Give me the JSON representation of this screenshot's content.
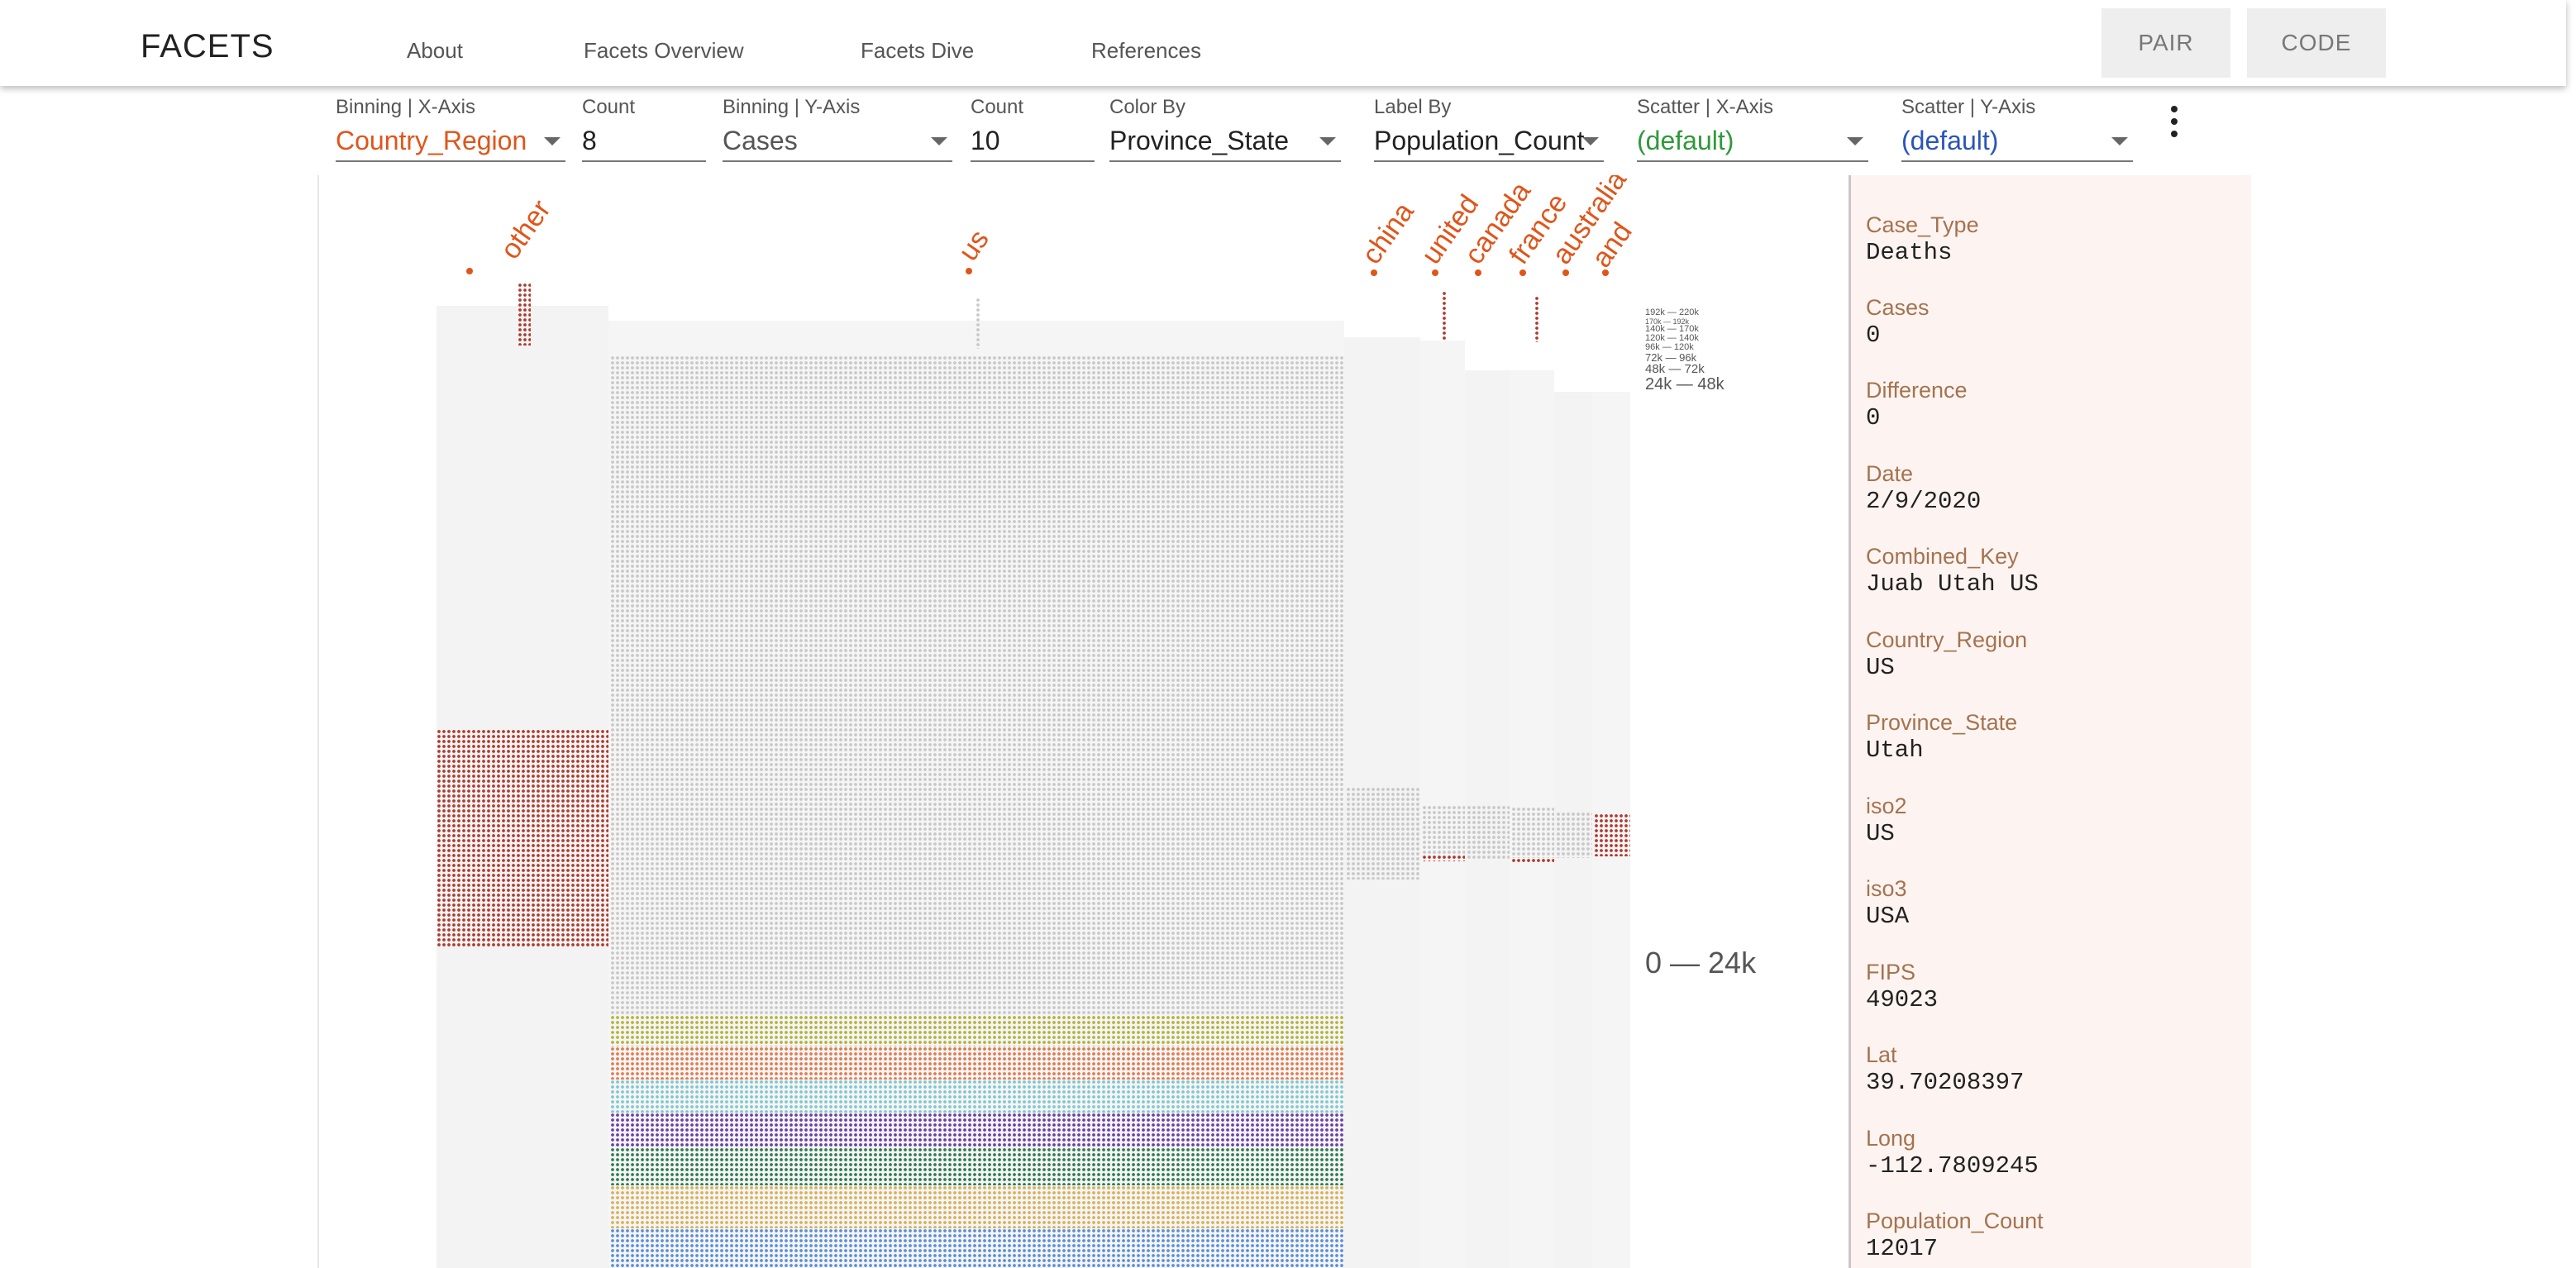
{
  "app": {
    "brand": "FACETS",
    "nav": [
      "About",
      "Facets Overview",
      "Facets Dive",
      "References"
    ],
    "buttons": {
      "pair": "PAIR",
      "code": "CODE"
    }
  },
  "controls": {
    "binning_x": {
      "label": "Binning | X-Axis",
      "value": "Country_Region",
      "color": "#e0551a"
    },
    "count_x": {
      "label": "Count",
      "value": "8"
    },
    "binning_y": {
      "label": "Binning | Y-Axis",
      "value": "Cases",
      "color": "#555555"
    },
    "count_y": {
      "label": "Count",
      "value": "10"
    },
    "color_by": {
      "label": "Color By",
      "value": "Province_State"
    },
    "label_by": {
      "label": "Label By",
      "value": "Population_Count"
    },
    "scatter_x": {
      "label": "Scatter | X-Axis",
      "value": "(default)",
      "color": "#2e9a3a"
    },
    "scatter_y": {
      "label": "Scatter | Y-Axis",
      "value": "(default)",
      "color": "#2a55b8"
    }
  },
  "viz": {
    "x_bins": [
      "other",
      "us",
      "china",
      "united",
      "canada",
      "france",
      "australia",
      "and"
    ],
    "y_ranges": [
      "192k — 220k",
      "170k — 192k",
      "140k — 170k",
      "120k — 140k",
      "96k — 120k",
      "72k — 96k",
      "48k — 72k",
      "24k — 48k",
      "0 — 24k"
    ],
    "colors": {
      "gray": "#c8c8c8",
      "red": "#b03a2e",
      "olive": "#b3b33c",
      "orange": "#e07b4f",
      "teal": "#7fc7cf",
      "purple": "#6a3fa8",
      "green": "#2e7d4f",
      "gold": "#d7b15a",
      "blue": "#5b8fd8",
      "accent": "#e0551a"
    }
  },
  "details": {
    "fields": [
      {
        "name": "Case_Type",
        "value": "Deaths"
      },
      {
        "name": "Cases",
        "value": "0"
      },
      {
        "name": "Difference",
        "value": "0"
      },
      {
        "name": "Date",
        "value": "2/9/2020"
      },
      {
        "name": "Combined_Key",
        "value": "Juab Utah US"
      },
      {
        "name": "Country_Region",
        "value": "US"
      },
      {
        "name": "Province_State",
        "value": "Utah"
      },
      {
        "name": "iso2",
        "value": "US"
      },
      {
        "name": "iso3",
        "value": "USA"
      },
      {
        "name": "FIPS",
        "value": "49023"
      },
      {
        "name": "Lat",
        "value": "39.70208397"
      },
      {
        "name": "Long",
        "value": "-112.7809245"
      },
      {
        "name": "Population_Count",
        "value": "12017"
      }
    ]
  }
}
